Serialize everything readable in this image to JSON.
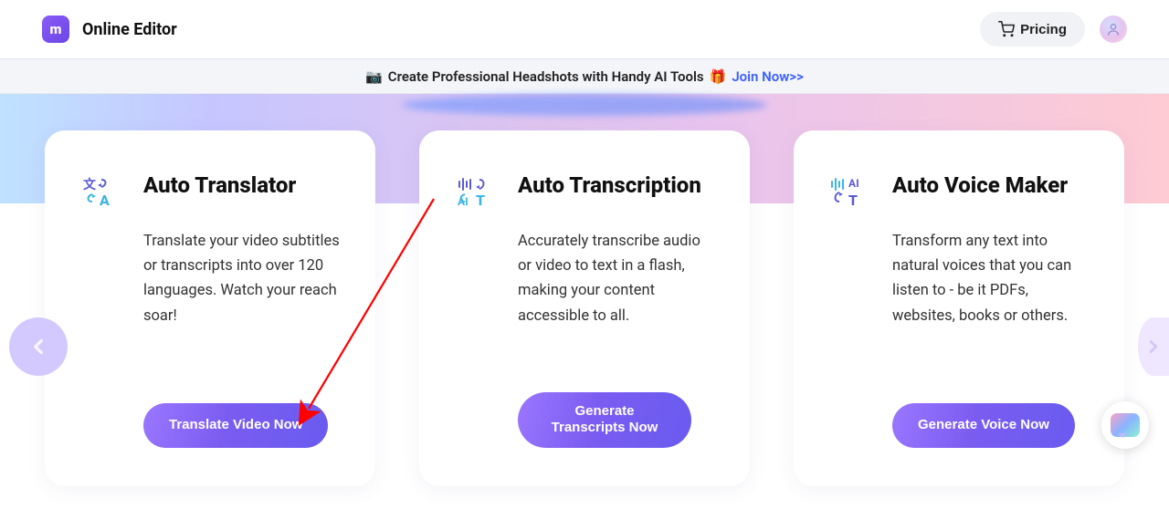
{
  "header": {
    "app_title": "Online Editor",
    "pricing_label": "Pricing"
  },
  "promo": {
    "text": "Create Professional Headshots with Handy AI Tools",
    "cta": "Join Now>>"
  },
  "cards": [
    {
      "title": "Auto Translator",
      "desc": "Translate your video subtitles or transcripts into over 120 languages. Watch your reach soar!",
      "button": "Translate Video Now"
    },
    {
      "title": "Auto Transcription",
      "desc": "Accurately transcribe audio or video to text in a flash, making your content accessible to all.",
      "button": "Generate Transcripts Now"
    },
    {
      "title": "Auto Voice Maker",
      "desc": "Transform any text into natural voices that you can listen to - be it PDFs, websites, books or others.",
      "button": "Generate Voice Now"
    }
  ]
}
